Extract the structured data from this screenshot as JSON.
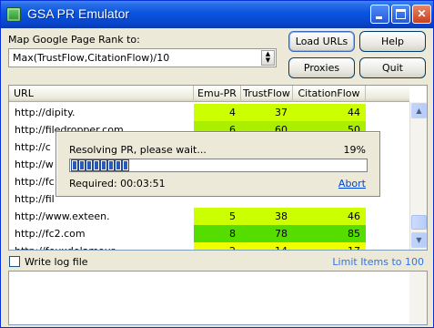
{
  "window": {
    "title": "GSA PR Emulator"
  },
  "controls": {
    "rank_label": "Map Google Page Rank to:",
    "formula": "Max(TrustFlow,CitationFlow)/10"
  },
  "buttons": {
    "load_urls": "Load URLs",
    "help": "Help",
    "proxies": "Proxies",
    "quit": "Quit"
  },
  "table": {
    "headers": [
      "URL",
      "Emu-PR",
      "TrustFlow",
      "CitationFlow"
    ],
    "rows": [
      {
        "url": "http://dipity.",
        "emu": "4",
        "tf": "37",
        "cf": "44",
        "color": "#ccff00"
      },
      {
        "url": "http://filedropper.com",
        "emu": "6",
        "tf": "60",
        "cf": "50",
        "color": "#aaee00"
      },
      {
        "url": "http://c",
        "emu": "",
        "tf": "",
        "cf": "",
        "color": "#ffffff"
      },
      {
        "url": "http://w",
        "emu": "",
        "tf": "",
        "cf": "",
        "color": "#ffffff"
      },
      {
        "url": "http://fc",
        "emu": "",
        "tf": "",
        "cf": "",
        "color": "#ffffff"
      },
      {
        "url": "http://fil",
        "emu": "",
        "tf": "",
        "cf": "",
        "color": "#ffffff"
      },
      {
        "url": "http://www.exteen.",
        "emu": "5",
        "tf": "38",
        "cf": "46",
        "color": "#ccff00"
      },
      {
        "url": "http://fc2.com",
        "emu": "8",
        "tf": "78",
        "cf": "85",
        "color": "#55dd00"
      },
      {
        "url": "http://feuxdelamour",
        "emu": "2",
        "tf": "14",
        "cf": "17",
        "color": "#f0ff00"
      }
    ]
  },
  "progress_dialog": {
    "message": "Resolving PR, please wait...",
    "percent": "19%",
    "progress_fraction": 0.19,
    "required": "Required: 00:03:51",
    "abort": "Abort"
  },
  "footer": {
    "write_log": "Write log file",
    "limit_items": "Limit Items to 100"
  }
}
